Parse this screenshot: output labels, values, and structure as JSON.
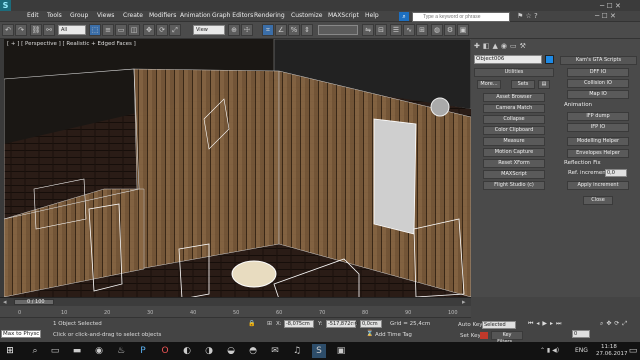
{
  "menu": [
    "Edit",
    "Tools",
    "Group",
    "Views",
    "Create",
    "Modifiers",
    "Animation",
    "Graph Editors",
    "Rendering",
    "Customize",
    "MAXScript",
    "Help"
  ],
  "search": {
    "placeholder": "Type a keyword or phrase"
  },
  "toolbar": {
    "selection_filter": "All",
    "ref_coord": "View"
  },
  "viewport": {
    "label": "[ + ] [ Perspective ] [ Realistic + Edged Faces ]"
  },
  "command_panel": {
    "object_name": "Object006",
    "object_color": "#1d8ae6",
    "utilities_title": "Utilities",
    "more_label": "More...",
    "sets_label": "Sets",
    "buttons": [
      "Asset Browser",
      "Camera Match",
      "Collapse",
      "Color Clipboard",
      "Measure",
      "Motion Capture",
      "Reset XForm",
      "MAXScript",
      "Flight Studio (c)"
    ]
  },
  "kam_panel": {
    "title": "Kam's GTA Scripts",
    "buttons_top": [
      "DFF IO",
      "Collision IO",
      "Map IO"
    ],
    "animation_label": "Animation",
    "ifp_buttons": [
      "IFP dump",
      "IFP IO"
    ],
    "buttons_mid": [
      "Modelling Helper",
      "Envelopes Helper"
    ],
    "reflection_label": "Reflection Fix",
    "ref_increment_label": "Ref. increment",
    "ref_increment_value": "0,0",
    "apply_label": "Apply increment",
    "close_label": "Close"
  },
  "timeline": {
    "frame_counter": "0 / 100",
    "ticks": [
      "0",
      "10",
      "20",
      "30",
      "40",
      "50",
      "60",
      "70",
      "80",
      "90",
      "100"
    ]
  },
  "status": {
    "maxscript_label": "Max to Physc",
    "selected": "1 Object Selected",
    "hint": "Click or click-and-drag to select objects",
    "x": "-8,075cm",
    "y": "-517,872cm",
    "z": "0,0cm",
    "grid": "Grid = 25,4cm",
    "add_time_tag": "Add Time Tag",
    "auto_key": "Auto Key",
    "auto_key_mode": "Selected",
    "set_key": "Set Key",
    "key_filters": "Key Filters...",
    "current_frame": "0"
  },
  "taskbar": {
    "lang": "ENG",
    "time": "11:18",
    "date": "27.06.2017"
  },
  "colors": {
    "accent": "#1d8ae6",
    "key_red": "#c0392b",
    "taskbar": "#121212"
  }
}
